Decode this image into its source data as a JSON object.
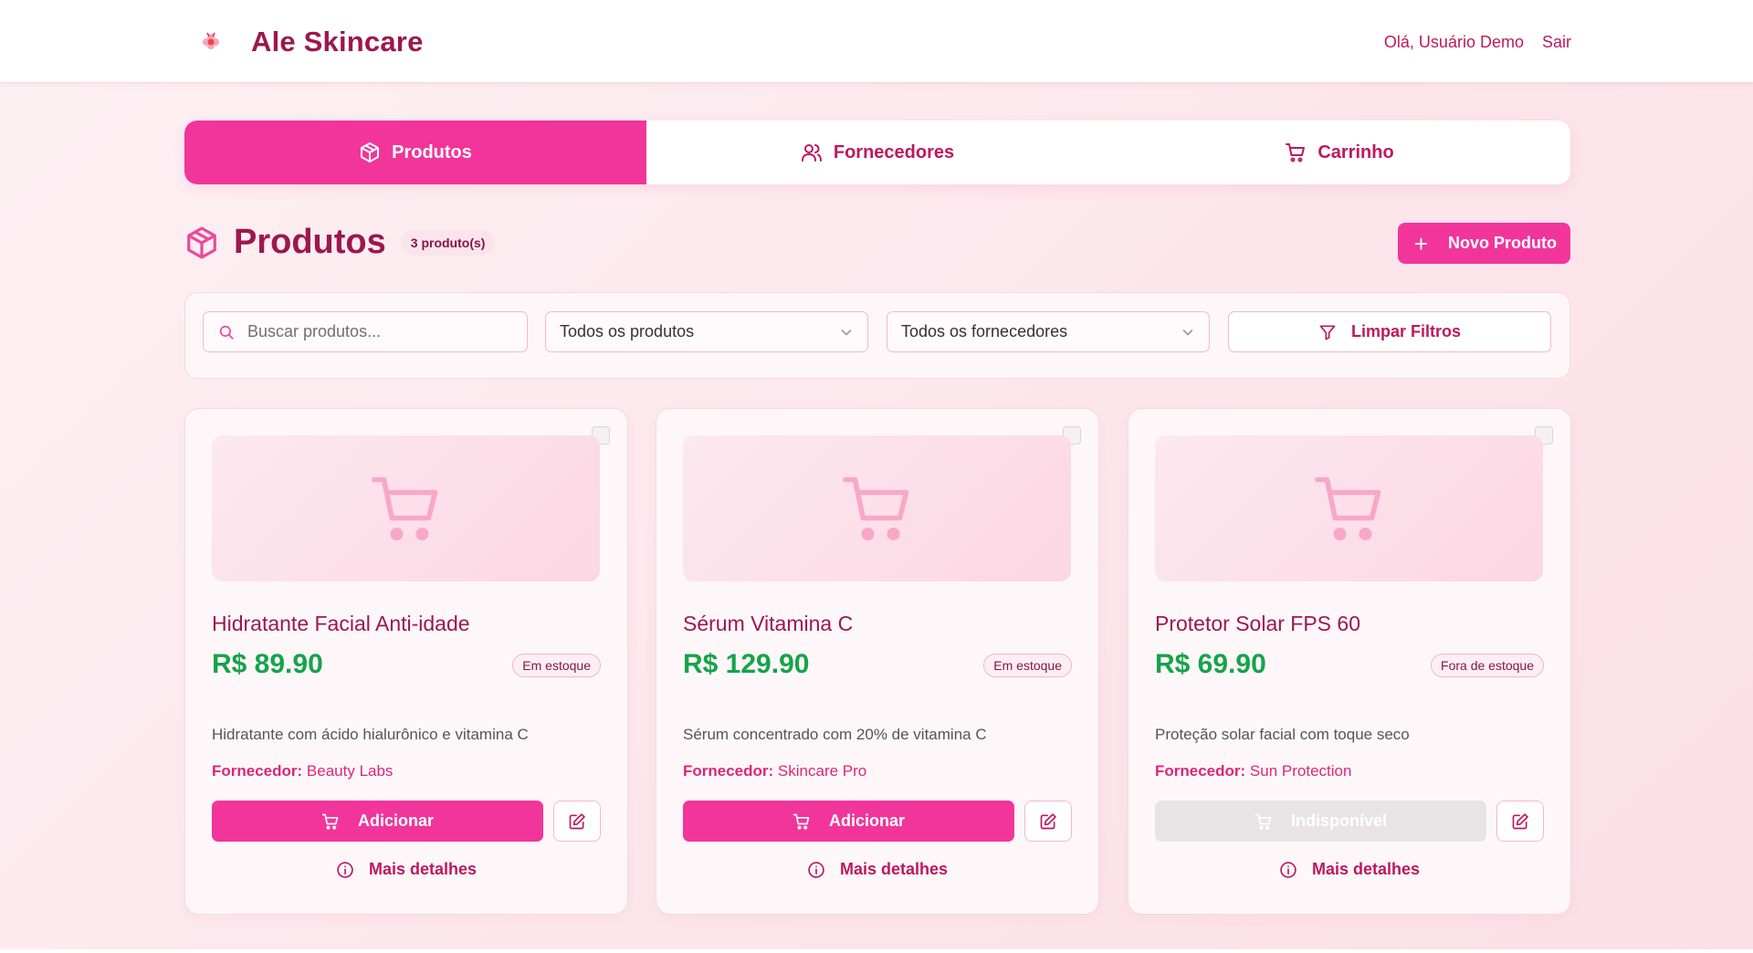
{
  "header": {
    "brand_name": "Ale Skincare",
    "greeting": "Olá, Usuário Demo",
    "logout_label": "Sair"
  },
  "tabs": [
    {
      "label": "Produtos",
      "icon": "package-icon",
      "active": true
    },
    {
      "label": "Fornecedores",
      "icon": "users-icon",
      "active": false
    },
    {
      "label": "Carrinho",
      "icon": "cart-icon",
      "active": false
    }
  ],
  "section": {
    "title": "Produtos",
    "count_badge": "3 produto(s)",
    "new_button_label": "Novo Produto"
  },
  "filters": {
    "search_placeholder": "Buscar produtos...",
    "product_filter_value": "Todos os produtos",
    "supplier_filter_value": "Todos os fornecedores",
    "clear_label": "Limpar Filtros"
  },
  "products": [
    {
      "name": "Hidratante Facial Anti-idade",
      "price": "R$ 89.90",
      "stock": "Em estoque",
      "description": "Hidratante com ácido hialurônico e vitamina C",
      "supplier_label": "Fornecedor:",
      "supplier": "Beauty Labs",
      "action_label": "Adicionar",
      "details_label": "Mais detalhes"
    },
    {
      "name": "Sérum Vitamina C",
      "price": "R$ 129.90",
      "stock": "Em estoque",
      "description": "Sérum concentrado com 20% de vitamina C",
      "supplier_label": "Fornecedor:",
      "supplier": "Skincare Pro",
      "action_label": "Adicionar",
      "details_label": "Mais detalhes"
    },
    {
      "name": "Protetor Solar FPS 60",
      "price": "R$ 69.90",
      "stock": "Fora de estoque",
      "description": "Proteção solar facial com toque seco",
      "supplier_label": "Fornecedor:",
      "supplier": "Sun Protection",
      "action_label": "Indisponível",
      "details_label": "Mais detalhes"
    }
  ],
  "colors": {
    "accent": "#f1359a",
    "brand_text": "#9d174d",
    "price": "#16a34a",
    "disabled": "#e8e4e6"
  }
}
